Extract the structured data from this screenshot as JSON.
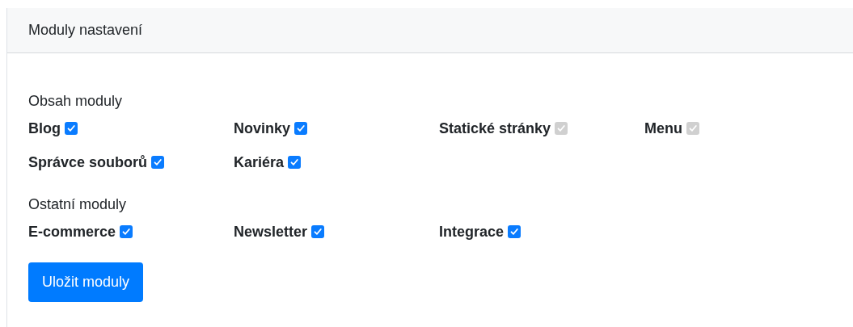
{
  "card": {
    "title": "Moduly nastavení"
  },
  "sections": [
    {
      "title": "Obsah moduly",
      "modules": [
        {
          "label": "Blog",
          "checked": true,
          "disabled": false
        },
        {
          "label": "Novinky",
          "checked": true,
          "disabled": false
        },
        {
          "label": "Statické stránky",
          "checked": true,
          "disabled": true
        },
        {
          "label": "Menu",
          "checked": true,
          "disabled": true
        },
        {
          "label": "Správce souborů",
          "checked": true,
          "disabled": false
        },
        {
          "label": "Kariéra",
          "checked": true,
          "disabled": false
        }
      ]
    },
    {
      "title": "Ostatní moduly",
      "modules": [
        {
          "label": "E-commerce",
          "checked": true,
          "disabled": false
        },
        {
          "label": "Newsletter",
          "checked": true,
          "disabled": false
        },
        {
          "label": "Integrace",
          "checked": true,
          "disabled": false
        }
      ]
    }
  ],
  "save_button": "Uložit moduly"
}
